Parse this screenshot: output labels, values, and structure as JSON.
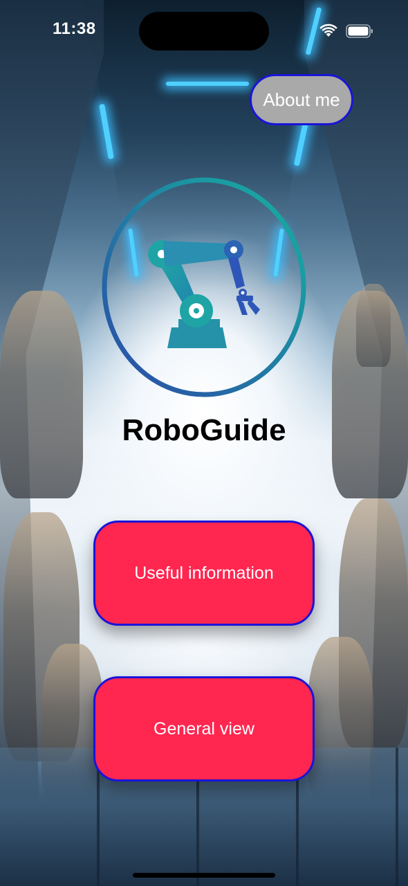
{
  "status_bar": {
    "time": "11:38",
    "icons": [
      "wifi-icon",
      "battery-icon"
    ]
  },
  "header": {
    "about_label": "About me"
  },
  "logo": {
    "icon": "robot-arm-icon",
    "ring_gradient": [
      "#2c4aa8",
      "#14b3a0"
    ]
  },
  "app": {
    "title": "RoboGuide"
  },
  "menu": {
    "useful_info_label": "Useful information",
    "general_view_label": "General view"
  },
  "colors": {
    "primary_button": "#ff2650",
    "button_border": "#1a14d9",
    "about_button": "#a9a9a9"
  }
}
